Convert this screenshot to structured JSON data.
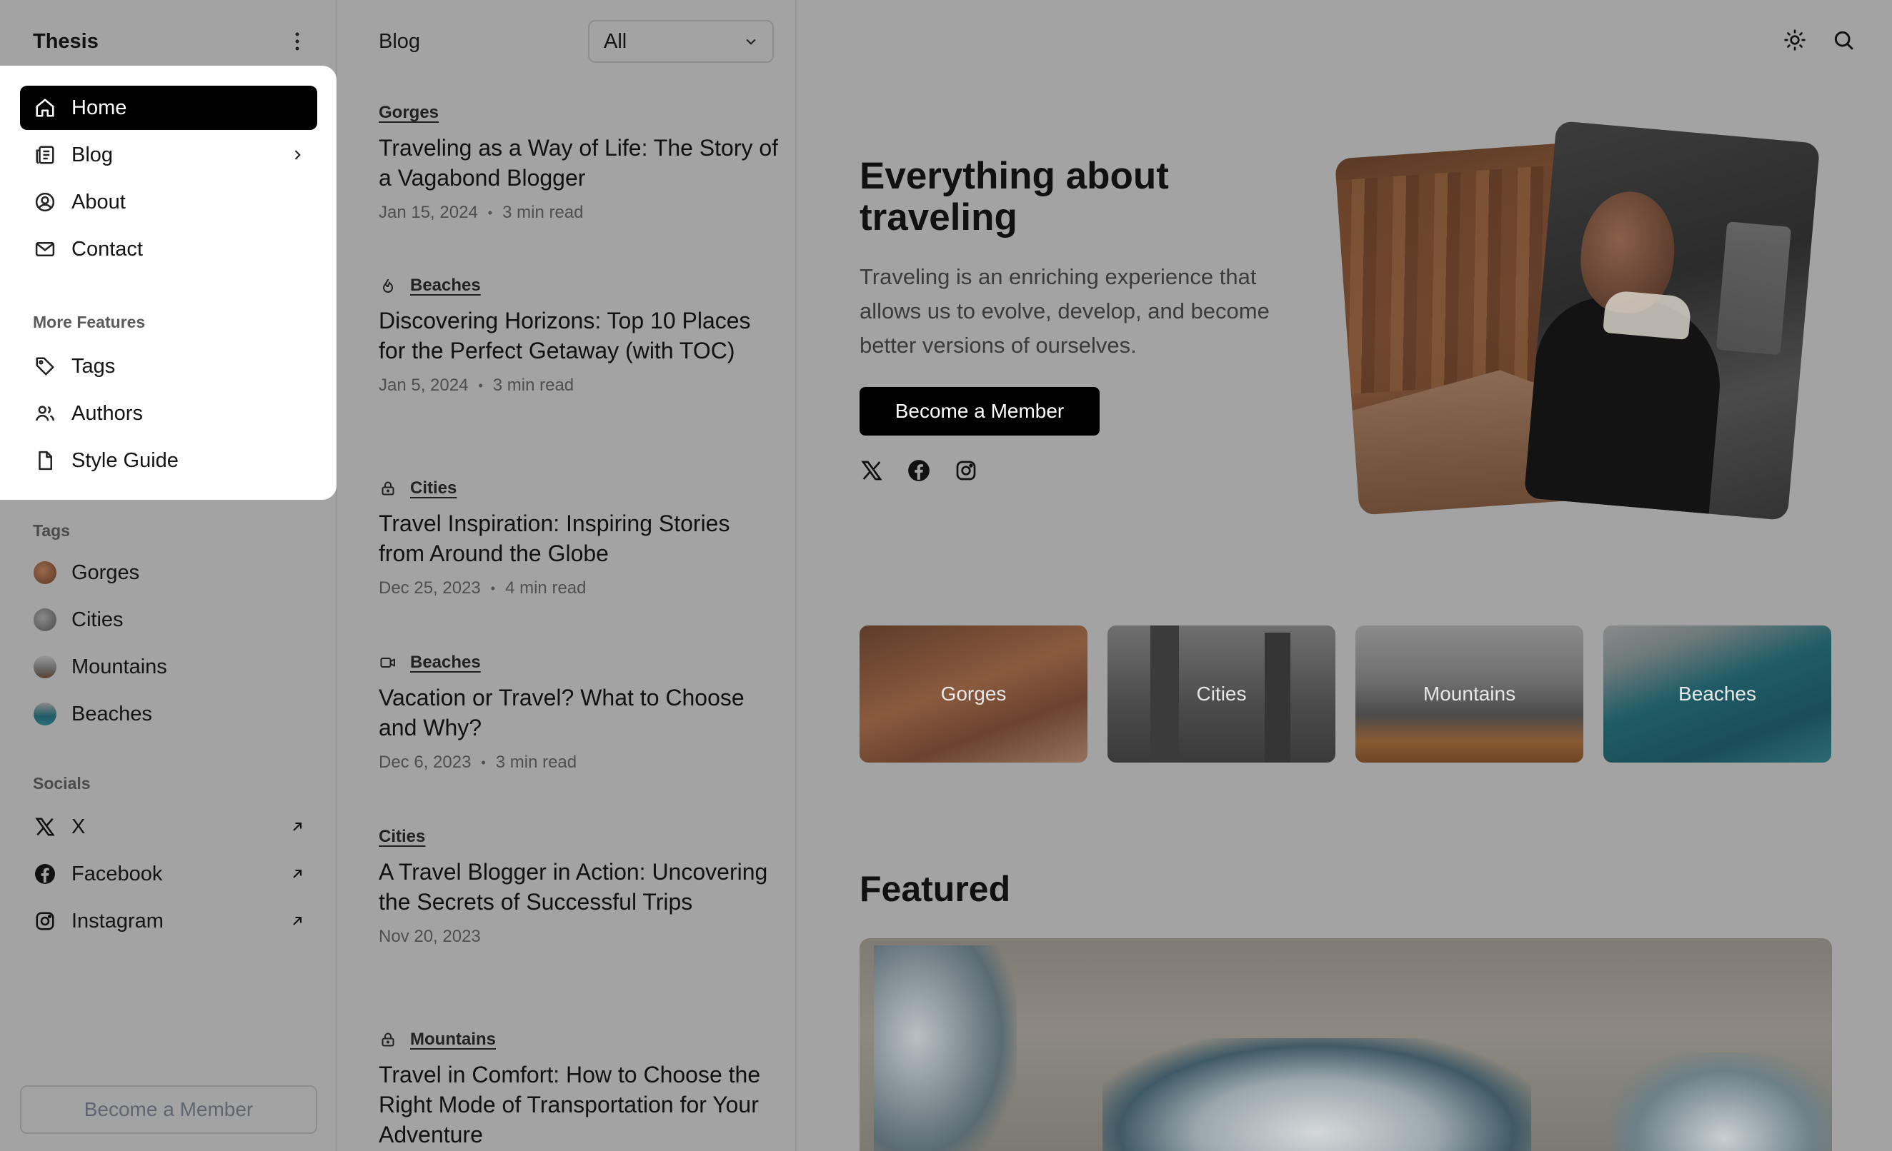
{
  "sidebar": {
    "brand": "Thesis",
    "nav": [
      {
        "label": "Home",
        "icon": "home-icon",
        "active": true
      },
      {
        "label": "Blog",
        "icon": "blog-icon"
      },
      {
        "label": "About",
        "icon": "user-circle-icon"
      },
      {
        "label": "Contact",
        "icon": "mail-icon"
      }
    ],
    "more_features_title": "More Features",
    "more_features": [
      {
        "label": "Tags",
        "icon": "tag-icon"
      },
      {
        "label": "Authors",
        "icon": "users-icon"
      },
      {
        "label": "Style Guide",
        "icon": "file-icon"
      }
    ],
    "tags_title": "Tags",
    "tags": [
      {
        "label": "Gorges",
        "color": "#7a4b34"
      },
      {
        "label": "Cities",
        "color": "#5a5a5a"
      },
      {
        "label": "Mountains",
        "color": "#6e6e6e"
      },
      {
        "label": "Beaches",
        "color": "#1f5c66"
      }
    ],
    "socials_title": "Socials",
    "socials": [
      {
        "label": "X",
        "icon": "x-icon"
      },
      {
        "label": "Facebook",
        "icon": "facebook-icon"
      },
      {
        "label": "Instagram",
        "icon": "instagram-icon"
      }
    ],
    "member_button": "Become a Member"
  },
  "postlist": {
    "title": "Blog",
    "filter": "All",
    "posts": [
      {
        "category": "Gorges",
        "icon": "",
        "title": "Traveling as a Way of Life: The Story of a Vagabond Blogger",
        "date": "Jan 15, 2024",
        "read": "3 min read"
      },
      {
        "category": "Beaches",
        "icon": "flame-icon",
        "title": "Discovering Horizons: Top 10 Places for the Perfect Getaway (with TOC)",
        "date": "Jan 5, 2024",
        "read": "3 min read"
      },
      {
        "category": "Cities",
        "icon": "lock-icon",
        "title": "Travel Inspiration: Inspiring Stories from Around the Globe",
        "date": "Dec 25, 2023",
        "read": "4 min read"
      },
      {
        "category": "Beaches",
        "icon": "video-icon",
        "title": "Vacation or Travel? What to Choose and Why?",
        "date": "Dec 6, 2023",
        "read": "3 min read"
      },
      {
        "category": "Cities",
        "icon": "",
        "title": "A Travel Blogger in Action: Uncovering the Secrets of Successful Trips",
        "date": "Nov 20, 2023",
        "read": ""
      },
      {
        "category": "Mountains",
        "icon": "lock-icon",
        "title": "Travel in Comfort: How to Choose the Right Mode of Transportation for Your Adventure",
        "date": "",
        "read": ""
      }
    ]
  },
  "main": {
    "hero_title": "Everything about traveling",
    "hero_desc": "Traveling is an enriching experience that allows us to evolve, develop, and become better versions of ourselves.",
    "hero_button": "Become a Member",
    "tag_cards": [
      "Gorges",
      "Cities",
      "Mountains",
      "Beaches"
    ],
    "featured_title": "Featured"
  }
}
